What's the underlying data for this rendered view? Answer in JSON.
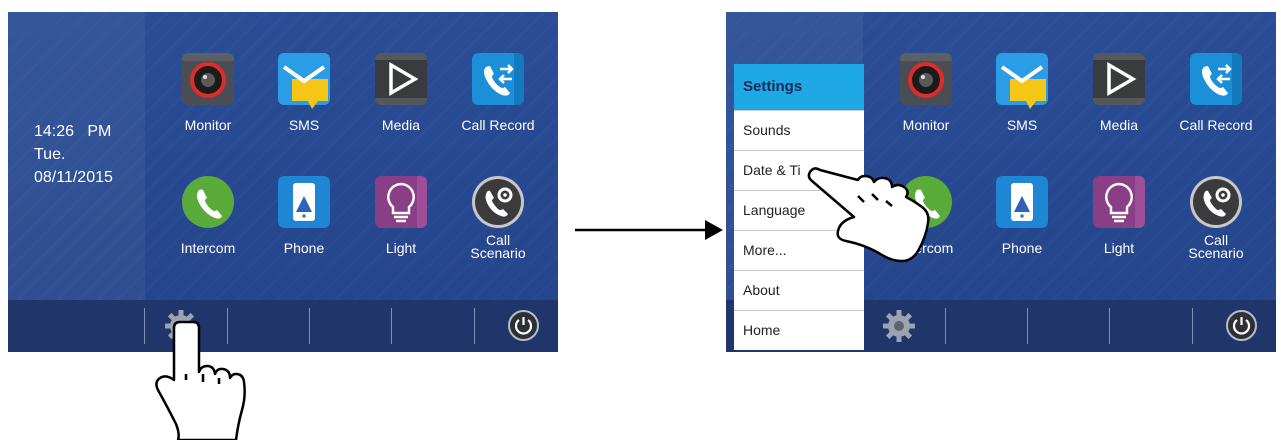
{
  "left_screen": {
    "time": "14:26   PM",
    "day": "Tue.",
    "date": "08/11/2015",
    "apps": [
      {
        "label": "Monitor",
        "icon": "camera-icon"
      },
      {
        "label": "SMS",
        "icon": "envelope-icon"
      },
      {
        "label": "Media",
        "icon": "play-icon"
      },
      {
        "label": "Call Record",
        "icon": "call-transfer-icon"
      },
      {
        "label": "Intercom",
        "icon": "phone-handset-icon"
      },
      {
        "label": "Phone",
        "icon": "mobile-phone-icon"
      },
      {
        "label": "Light",
        "icon": "light-bulb-icon"
      },
      {
        "label": "Call\nScenario",
        "icon": "call-settings-icon"
      }
    ]
  },
  "right_screen": {
    "settings_menu": {
      "title": "Settings",
      "items": [
        "Sounds",
        "Date & Ti",
        "Language",
        "More...",
        "About",
        "Home"
      ]
    },
    "apps": [
      {
        "label": "Monitor"
      },
      {
        "label": "SMS"
      },
      {
        "label": "Media"
      },
      {
        "label": "Call Record"
      },
      {
        "label": "Intercom"
      },
      {
        "label": "Phone"
      },
      {
        "label": "Light"
      },
      {
        "label": "Call\nScenario"
      }
    ]
  },
  "colors": {
    "screen_bg": "#2a4d96",
    "bottom_bar": "#20366a",
    "menu_header": "#1fa8e6"
  }
}
